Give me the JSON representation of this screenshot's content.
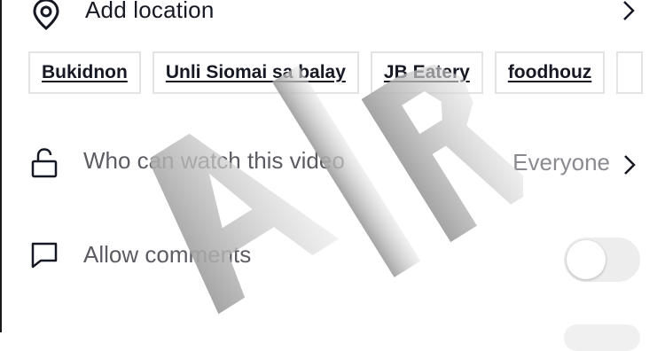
{
  "location": {
    "label": "Add location",
    "icon": "location-pin-icon"
  },
  "chips": [
    {
      "label": "Bukidnon"
    },
    {
      "label": "Unli Siomai sa balay"
    },
    {
      "label": "JB Eatery"
    },
    {
      "label": "foodhouz"
    }
  ],
  "privacy": {
    "label": "Who can watch this video",
    "value": "Everyone",
    "icon": "unlocked-padlock-icon"
  },
  "comments": {
    "label": "Allow comments",
    "enabled": false,
    "icon": "comment-bubble-icon"
  },
  "watermark": {
    "text": "AIR"
  },
  "colors": {
    "primary_text": "#161823",
    "secondary_text": "#5b5c63",
    "value_text": "#8a8b91",
    "chip_border": "#e3e3e4",
    "toggle_off": "#ededee"
  }
}
